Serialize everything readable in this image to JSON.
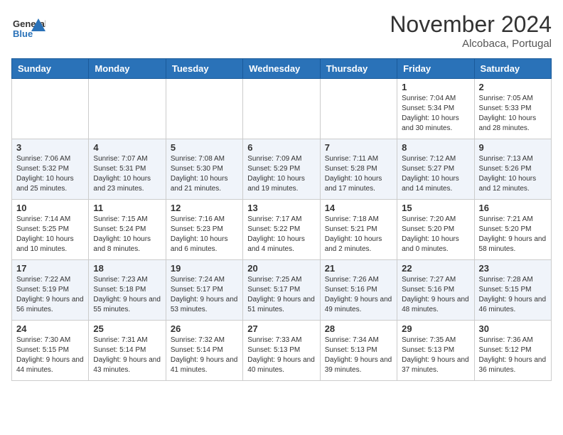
{
  "header": {
    "logo_line1": "General",
    "logo_line2": "Blue",
    "month": "November 2024",
    "location": "Alcobaca, Portugal"
  },
  "days_of_week": [
    "Sunday",
    "Monday",
    "Tuesday",
    "Wednesday",
    "Thursday",
    "Friday",
    "Saturday"
  ],
  "weeks": [
    [
      {
        "day": "",
        "info": ""
      },
      {
        "day": "",
        "info": ""
      },
      {
        "day": "",
        "info": ""
      },
      {
        "day": "",
        "info": ""
      },
      {
        "day": "",
        "info": ""
      },
      {
        "day": "1",
        "info": "Sunrise: 7:04 AM\nSunset: 5:34 PM\nDaylight: 10 hours and 30 minutes."
      },
      {
        "day": "2",
        "info": "Sunrise: 7:05 AM\nSunset: 5:33 PM\nDaylight: 10 hours and 28 minutes."
      }
    ],
    [
      {
        "day": "3",
        "info": "Sunrise: 7:06 AM\nSunset: 5:32 PM\nDaylight: 10 hours and 25 minutes."
      },
      {
        "day": "4",
        "info": "Sunrise: 7:07 AM\nSunset: 5:31 PM\nDaylight: 10 hours and 23 minutes."
      },
      {
        "day": "5",
        "info": "Sunrise: 7:08 AM\nSunset: 5:30 PM\nDaylight: 10 hours and 21 minutes."
      },
      {
        "day": "6",
        "info": "Sunrise: 7:09 AM\nSunset: 5:29 PM\nDaylight: 10 hours and 19 minutes."
      },
      {
        "day": "7",
        "info": "Sunrise: 7:11 AM\nSunset: 5:28 PM\nDaylight: 10 hours and 17 minutes."
      },
      {
        "day": "8",
        "info": "Sunrise: 7:12 AM\nSunset: 5:27 PM\nDaylight: 10 hours and 14 minutes."
      },
      {
        "day": "9",
        "info": "Sunrise: 7:13 AM\nSunset: 5:26 PM\nDaylight: 10 hours and 12 minutes."
      }
    ],
    [
      {
        "day": "10",
        "info": "Sunrise: 7:14 AM\nSunset: 5:25 PM\nDaylight: 10 hours and 10 minutes."
      },
      {
        "day": "11",
        "info": "Sunrise: 7:15 AM\nSunset: 5:24 PM\nDaylight: 10 hours and 8 minutes."
      },
      {
        "day": "12",
        "info": "Sunrise: 7:16 AM\nSunset: 5:23 PM\nDaylight: 10 hours and 6 minutes."
      },
      {
        "day": "13",
        "info": "Sunrise: 7:17 AM\nSunset: 5:22 PM\nDaylight: 10 hours and 4 minutes."
      },
      {
        "day": "14",
        "info": "Sunrise: 7:18 AM\nSunset: 5:21 PM\nDaylight: 10 hours and 2 minutes."
      },
      {
        "day": "15",
        "info": "Sunrise: 7:20 AM\nSunset: 5:20 PM\nDaylight: 10 hours and 0 minutes."
      },
      {
        "day": "16",
        "info": "Sunrise: 7:21 AM\nSunset: 5:20 PM\nDaylight: 9 hours and 58 minutes."
      }
    ],
    [
      {
        "day": "17",
        "info": "Sunrise: 7:22 AM\nSunset: 5:19 PM\nDaylight: 9 hours and 56 minutes."
      },
      {
        "day": "18",
        "info": "Sunrise: 7:23 AM\nSunset: 5:18 PM\nDaylight: 9 hours and 55 minutes."
      },
      {
        "day": "19",
        "info": "Sunrise: 7:24 AM\nSunset: 5:17 PM\nDaylight: 9 hours and 53 minutes."
      },
      {
        "day": "20",
        "info": "Sunrise: 7:25 AM\nSunset: 5:17 PM\nDaylight: 9 hours and 51 minutes."
      },
      {
        "day": "21",
        "info": "Sunrise: 7:26 AM\nSunset: 5:16 PM\nDaylight: 9 hours and 49 minutes."
      },
      {
        "day": "22",
        "info": "Sunrise: 7:27 AM\nSunset: 5:16 PM\nDaylight: 9 hours and 48 minutes."
      },
      {
        "day": "23",
        "info": "Sunrise: 7:28 AM\nSunset: 5:15 PM\nDaylight: 9 hours and 46 minutes."
      }
    ],
    [
      {
        "day": "24",
        "info": "Sunrise: 7:30 AM\nSunset: 5:15 PM\nDaylight: 9 hours and 44 minutes."
      },
      {
        "day": "25",
        "info": "Sunrise: 7:31 AM\nSunset: 5:14 PM\nDaylight: 9 hours and 43 minutes."
      },
      {
        "day": "26",
        "info": "Sunrise: 7:32 AM\nSunset: 5:14 PM\nDaylight: 9 hours and 41 minutes."
      },
      {
        "day": "27",
        "info": "Sunrise: 7:33 AM\nSunset: 5:13 PM\nDaylight: 9 hours and 40 minutes."
      },
      {
        "day": "28",
        "info": "Sunrise: 7:34 AM\nSunset: 5:13 PM\nDaylight: 9 hours and 39 minutes."
      },
      {
        "day": "29",
        "info": "Sunrise: 7:35 AM\nSunset: 5:13 PM\nDaylight: 9 hours and 37 minutes."
      },
      {
        "day": "30",
        "info": "Sunrise: 7:36 AM\nSunset: 5:12 PM\nDaylight: 9 hours and 36 minutes."
      }
    ]
  ]
}
